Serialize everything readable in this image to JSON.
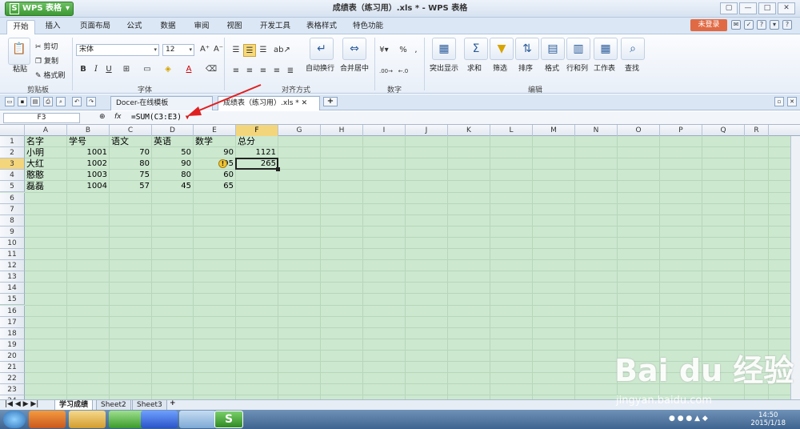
{
  "app": {
    "name": "WPS 表格",
    "logo_letter": "S",
    "window_title": "成绩表（练习用）.xls * - WPS 表格"
  },
  "window_controls": [
    "▢",
    "—",
    "□",
    "✕"
  ],
  "menu_tabs": [
    "开始",
    "插入",
    "页面布局",
    "公式",
    "数据",
    "审阅",
    "视图",
    "开发工具",
    "表格样式",
    "特色功能"
  ],
  "login_label": "未登录",
  "ribbon": {
    "clipboard": {
      "paste": "粘贴",
      "cut": "剪切",
      "copy": "复制",
      "format_painter": "格式刷",
      "group": "剪贴板"
    },
    "font": {
      "name": "宋体",
      "size": "12",
      "group": "字体",
      "bold": "B",
      "italic": "I",
      "underline": "U"
    },
    "align": {
      "wrap": "自动换行",
      "merge": "合并居中",
      "group": "对齐方式"
    },
    "number": {
      "percent": "%",
      "group": "数字"
    },
    "edit": {
      "highlight": "突出显示",
      "sum": "求和",
      "filter": "筛选",
      "sort": "排序",
      "format": "格式",
      "rows_cols": "行和列",
      "sheet": "工作表",
      "find": "查找",
      "group": "编辑"
    }
  },
  "doc_tabs": [
    {
      "label": "Docer-在线模板"
    },
    {
      "label": "成绩表（练习用）.xls *"
    }
  ],
  "name_box": "F3",
  "formula": "=SUM(C3:E3)",
  "columns": [
    "A",
    "B",
    "C",
    "D",
    "E",
    "F",
    "G",
    "H",
    "I",
    "J",
    "K",
    "L",
    "M",
    "N",
    "O",
    "P",
    "Q",
    "R"
  ],
  "rows": [
    "1",
    "2",
    "3",
    "4",
    "5",
    "6",
    "7",
    "8",
    "9",
    "10",
    "11",
    "12",
    "13",
    "14",
    "15",
    "16",
    "17",
    "18",
    "19",
    "20",
    "21",
    "22",
    "23",
    "24"
  ],
  "table": {
    "header": [
      "名字",
      "学号",
      "语文",
      "英语",
      "数学",
      "总分"
    ],
    "data": [
      [
        "小明",
        "1001",
        "70",
        "50",
        "90",
        "1121"
      ],
      [
        "大红",
        "1002",
        "80",
        "90",
        "95",
        "265"
      ],
      [
        "憨憨",
        "1003",
        "75",
        "80",
        "60",
        ""
      ],
      [
        "磊磊",
        "1004",
        "57",
        "45",
        "65",
        ""
      ]
    ]
  },
  "sheets": [
    "学习成绩",
    "Sheet2",
    "Sheet3"
  ],
  "clock": {
    "time": "14:50",
    "date": "2015/1/18"
  },
  "watermark": {
    "brand": "Bai du 经验",
    "url": "jingyan.baidu.com"
  },
  "colors": {
    "grid_bg": "#cce8cf",
    "accent": "#3c9a33",
    "login": "#e06a44"
  }
}
